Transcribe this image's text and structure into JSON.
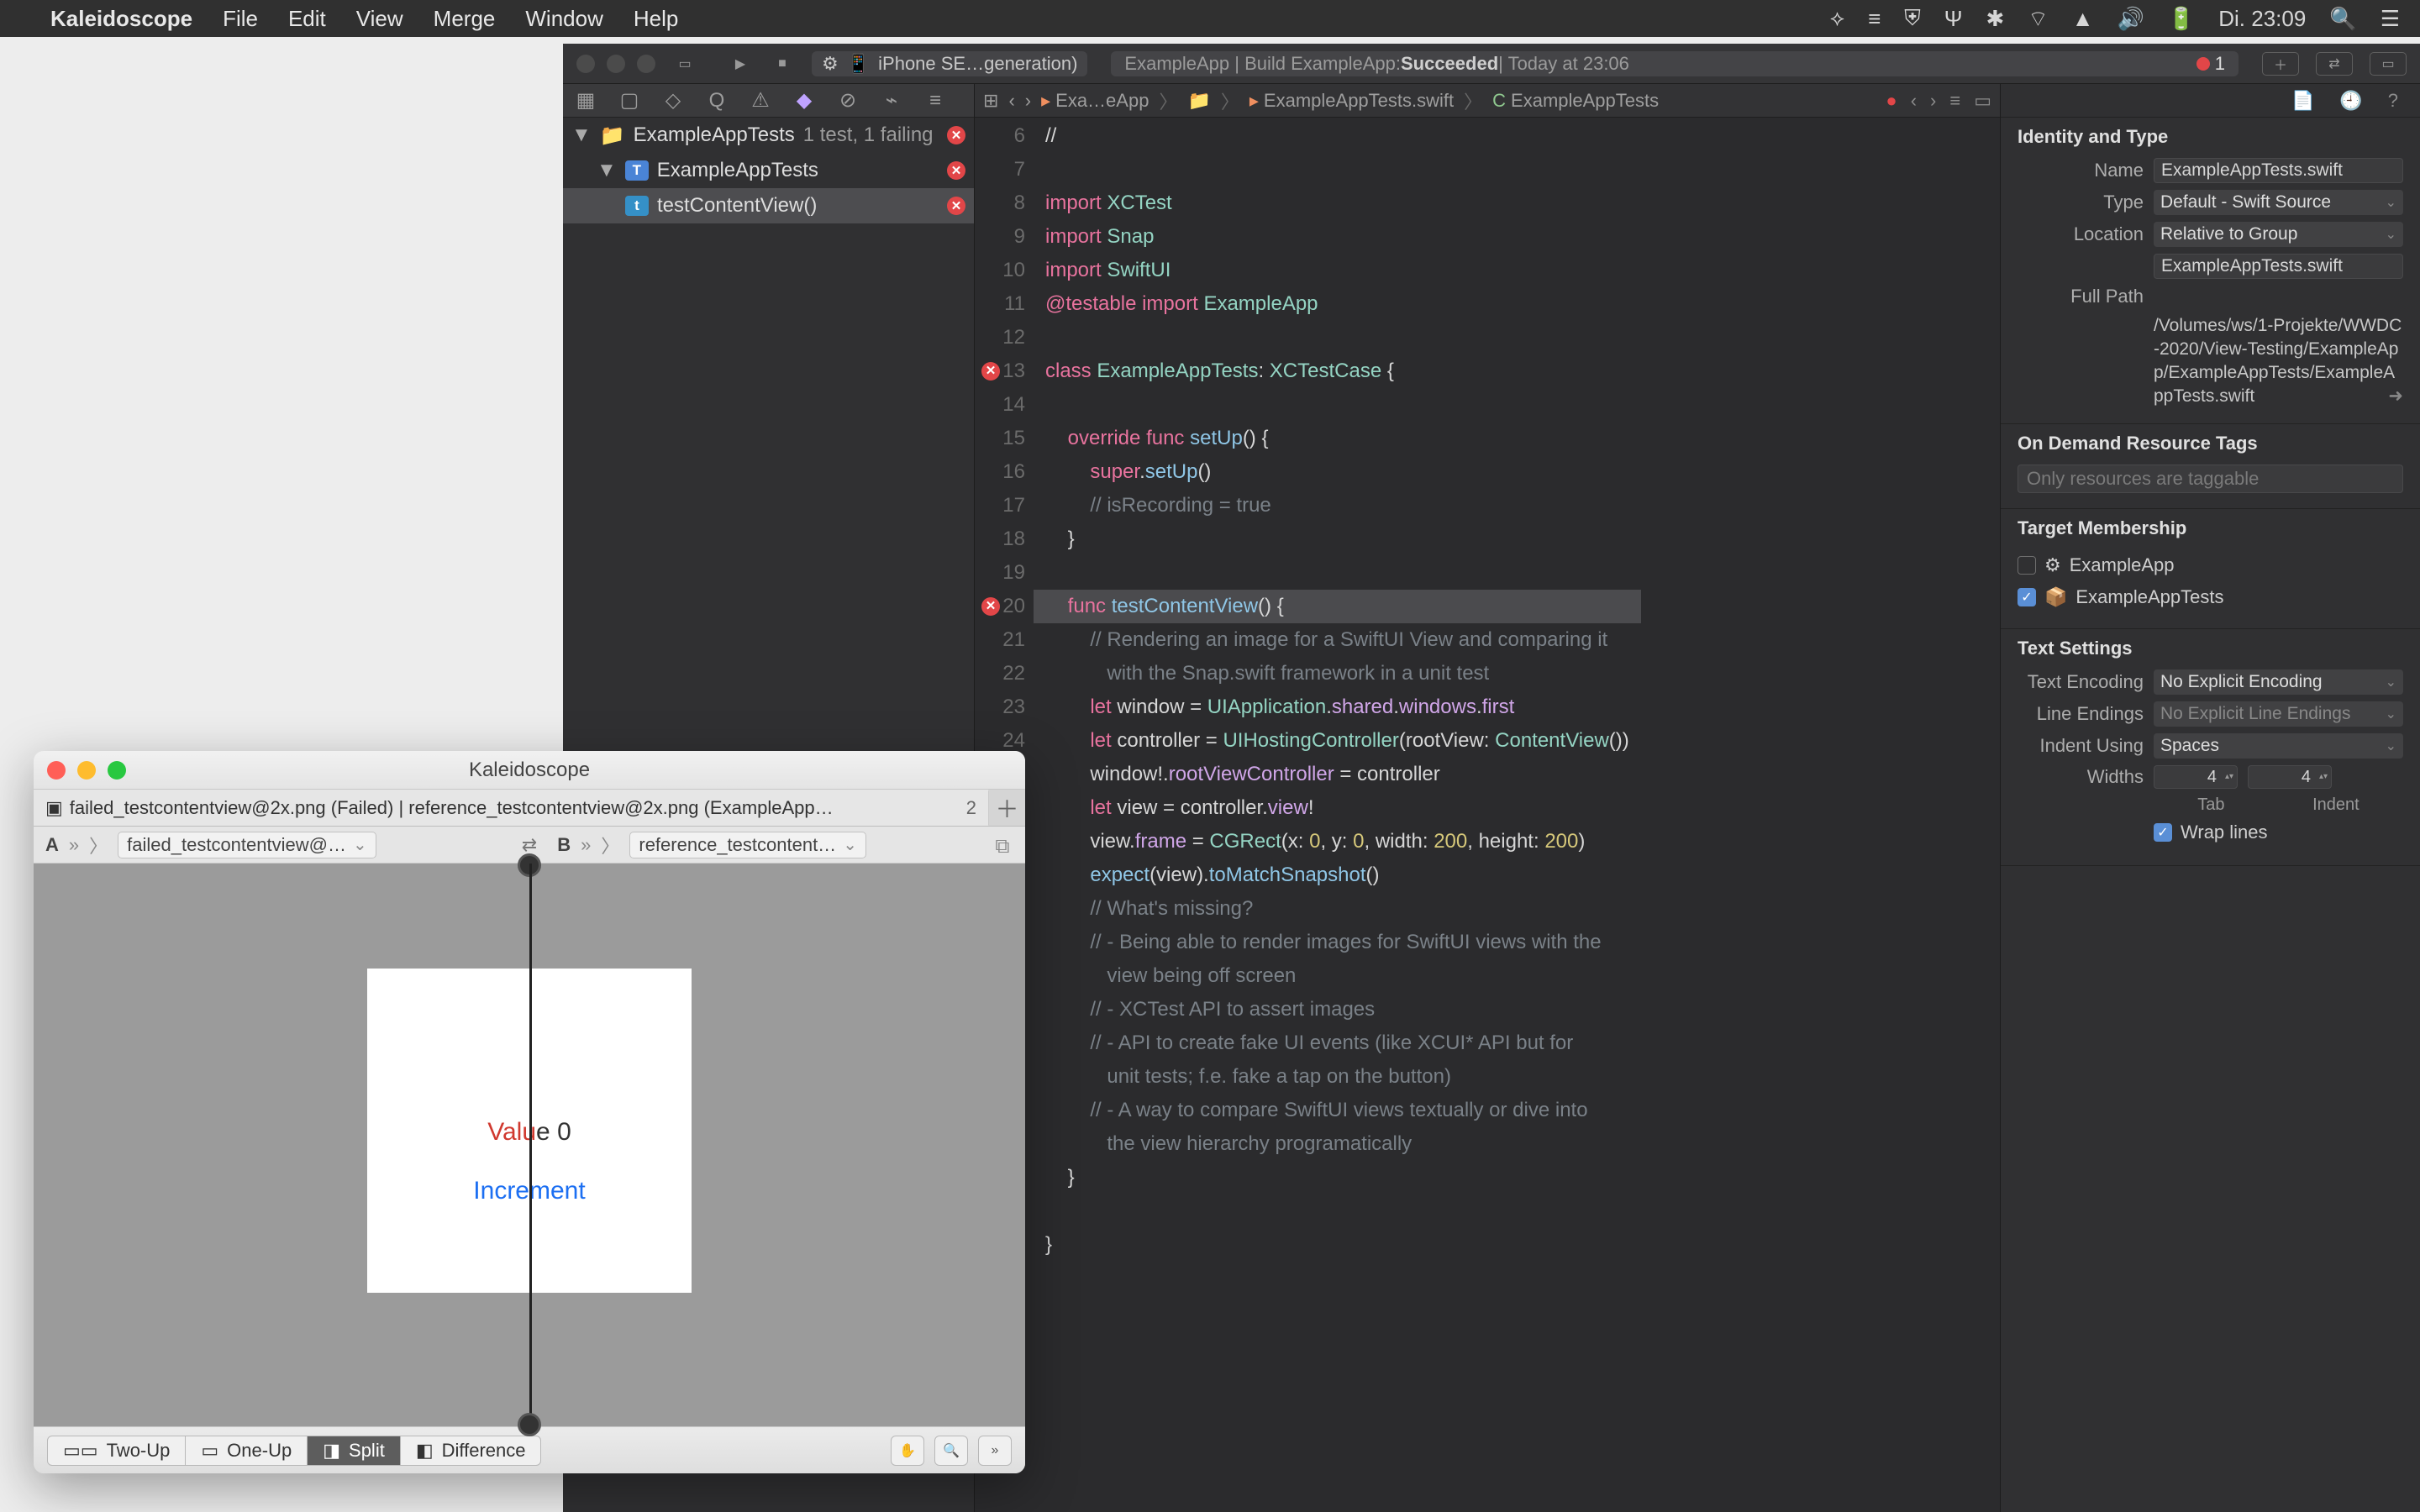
{
  "menubar": {
    "app": "Kaleidoscope",
    "items": [
      "File",
      "Edit",
      "View",
      "Merge",
      "Window",
      "Help"
    ],
    "clock": "Di. 23:09"
  },
  "xcode": {
    "scheme": "iPhone SE…generation)",
    "activity": {
      "prefix": "ExampleApp | Build ExampleApp: ",
      "status": "Succeeded",
      "suffix": " | Today at 23:06",
      "issue_count": "1"
    },
    "navigator": {
      "root": "ExampleAppTests",
      "root_sub": "1 test, 1 failing",
      "class_row": "ExampleAppTests",
      "test_row": "testContentView()"
    },
    "jump": {
      "a": "Exa…eApp",
      "b": "ExampleAppTests.swift",
      "c": "ExampleAppTests"
    },
    "gutter_start": 6,
    "code_lines": [
      {
        "t": "cmt",
        "s": "//"
      },
      {
        "t": "",
        "s": ""
      },
      {
        "t": "",
        "s": "<kw>import</kw> <type>XCTest</type>"
      },
      {
        "t": "",
        "s": "<kw>import</kw> <type>Snap</type>"
      },
      {
        "t": "",
        "s": "<kw>import</kw> <type>SwiftUI</type>"
      },
      {
        "t": "",
        "s": "<kw>@testable</kw> <kw>import</kw> <type>ExampleApp</type>"
      },
      {
        "t": "",
        "s": ""
      },
      {
        "t": "err",
        "s": "<kw>class</kw> <type>ExampleAppTests</type>: <type>XCTestCase</type> {"
      },
      {
        "t": "",
        "s": ""
      },
      {
        "t": "",
        "s": "    <kw>override</kw> <kw>func</kw> <fn>setUp</fn>() {"
      },
      {
        "t": "",
        "s": "        <kw>super</kw>.<fn>setUp</fn>()"
      },
      {
        "t": "",
        "s": "        <cmt>// isRecording = true</cmt>"
      },
      {
        "t": "",
        "s": "    }"
      },
      {
        "t": "",
        "s": ""
      },
      {
        "t": "err hl",
        "s": "    <kw>func</kw> <fn>testContentView</fn>() {"
      },
      {
        "t": "",
        "s": "        <cmt>// Rendering an image for a SwiftUI View and comparing it</cmt>"
      },
      {
        "t": "",
        "s": "           <cmt>with the Snap.swift framework in a unit test</cmt>"
      },
      {
        "t": "",
        "s": "        <kw>let</kw> window = <type>UIApplication</type>.<self>shared</self>.<self>windows</self>.<self>first</self>"
      },
      {
        "t": "",
        "s": "        <kw>let</kw> controller = <type>UIHostingController</type>(rootView: <type>ContentView</type>())"
      },
      {
        "t": "",
        "s": "        window!.<self>rootViewController</self> = controller"
      },
      {
        "t": "",
        "s": "        <kw>let</kw> view = controller.<self>view</self>!"
      },
      {
        "t": "",
        "s": "        view.<self>frame</self> = <type>CGRect</type>(x: <num>0</num>, y: <num>0</num>, width: <num>200</num>, height: <num>200</num>)"
      },
      {
        "t": "",
        "s": "        <fn>expect</fn>(view).<fn>toMatchSnapshot</fn>()"
      },
      {
        "t": "",
        "s": "        <cmt>// What's missing?</cmt>"
      },
      {
        "t": "",
        "s": "        <cmt>// - Being able to render images for SwiftUI views with the</cmt>"
      },
      {
        "t": "",
        "s": "           <cmt>view being off screen</cmt>"
      },
      {
        "t": "",
        "s": "        <cmt>// - XCTest API to assert images</cmt>"
      },
      {
        "t": "",
        "s": "        <cmt>// - API to create fake UI events (like XCUI* API but for</cmt>"
      },
      {
        "t": "",
        "s": "           <cmt>unit tests; f.e. fake a tap on the button)</cmt>"
      },
      {
        "t": "",
        "s": "        <cmt>// - A way to compare SwiftUI views textually or dive into</cmt>"
      },
      {
        "t": "",
        "s": "           <cmt>the view hierarchy programatically</cmt>"
      },
      {
        "t": "",
        "s": "    }"
      },
      {
        "t": "",
        "s": ""
      },
      {
        "t": "",
        "s": "}"
      }
    ],
    "inspector": {
      "identity_h": "Identity and Type",
      "name_lbl": "Name",
      "name": "ExampleAppTests.swift",
      "type_lbl": "Type",
      "type": "Default - Swift Source",
      "loc_lbl": "Location",
      "loc": "Relative to Group",
      "loc_file": "ExampleAppTests.swift",
      "fullpath_lbl": "Full Path",
      "fullpath": "/Volumes/ws/1-Projekte/WWDC-2020/View-Testing/ExampleApp/ExampleAppTests/ExampleAppTests.swift",
      "odr_h": "On Demand Resource Tags",
      "odr_ph": "Only resources are taggable",
      "tm_h": "Target Membership",
      "tm1": "ExampleApp",
      "tm2": "ExampleAppTests",
      "ts_h": "Text Settings",
      "te_lbl": "Text Encoding",
      "te": "No Explicit Encoding",
      "le_lbl": "Line Endings",
      "le": "No Explicit Line Endings",
      "iu_lbl": "Indent Using",
      "iu": "Spaces",
      "widths_lbl": "Widths",
      "w_tab": "4",
      "w_indent": "4",
      "tab_lbl": "Tab",
      "indent_lbl": "Indent",
      "wrap": "Wrap lines"
    }
  },
  "kscope": {
    "title": "Kaleidoscope",
    "tab_label": "failed_testcontentview@2x.png (Failed) | reference_testcontentview@2x.png (ExampleApp…",
    "tab_count": "2",
    "pathA_label": "A",
    "pathA_file": "failed_testcontentview@…",
    "pathB_label": "B",
    "pathB_file": "reference_testcontent…",
    "canvas_value_prefix": "Valu",
    "canvas_value_suffix": "e 0",
    "canvas_inc": "Increment",
    "footer": {
      "two": "Two-Up",
      "one": "One-Up",
      "split": "Split",
      "diff": "Difference"
    }
  }
}
